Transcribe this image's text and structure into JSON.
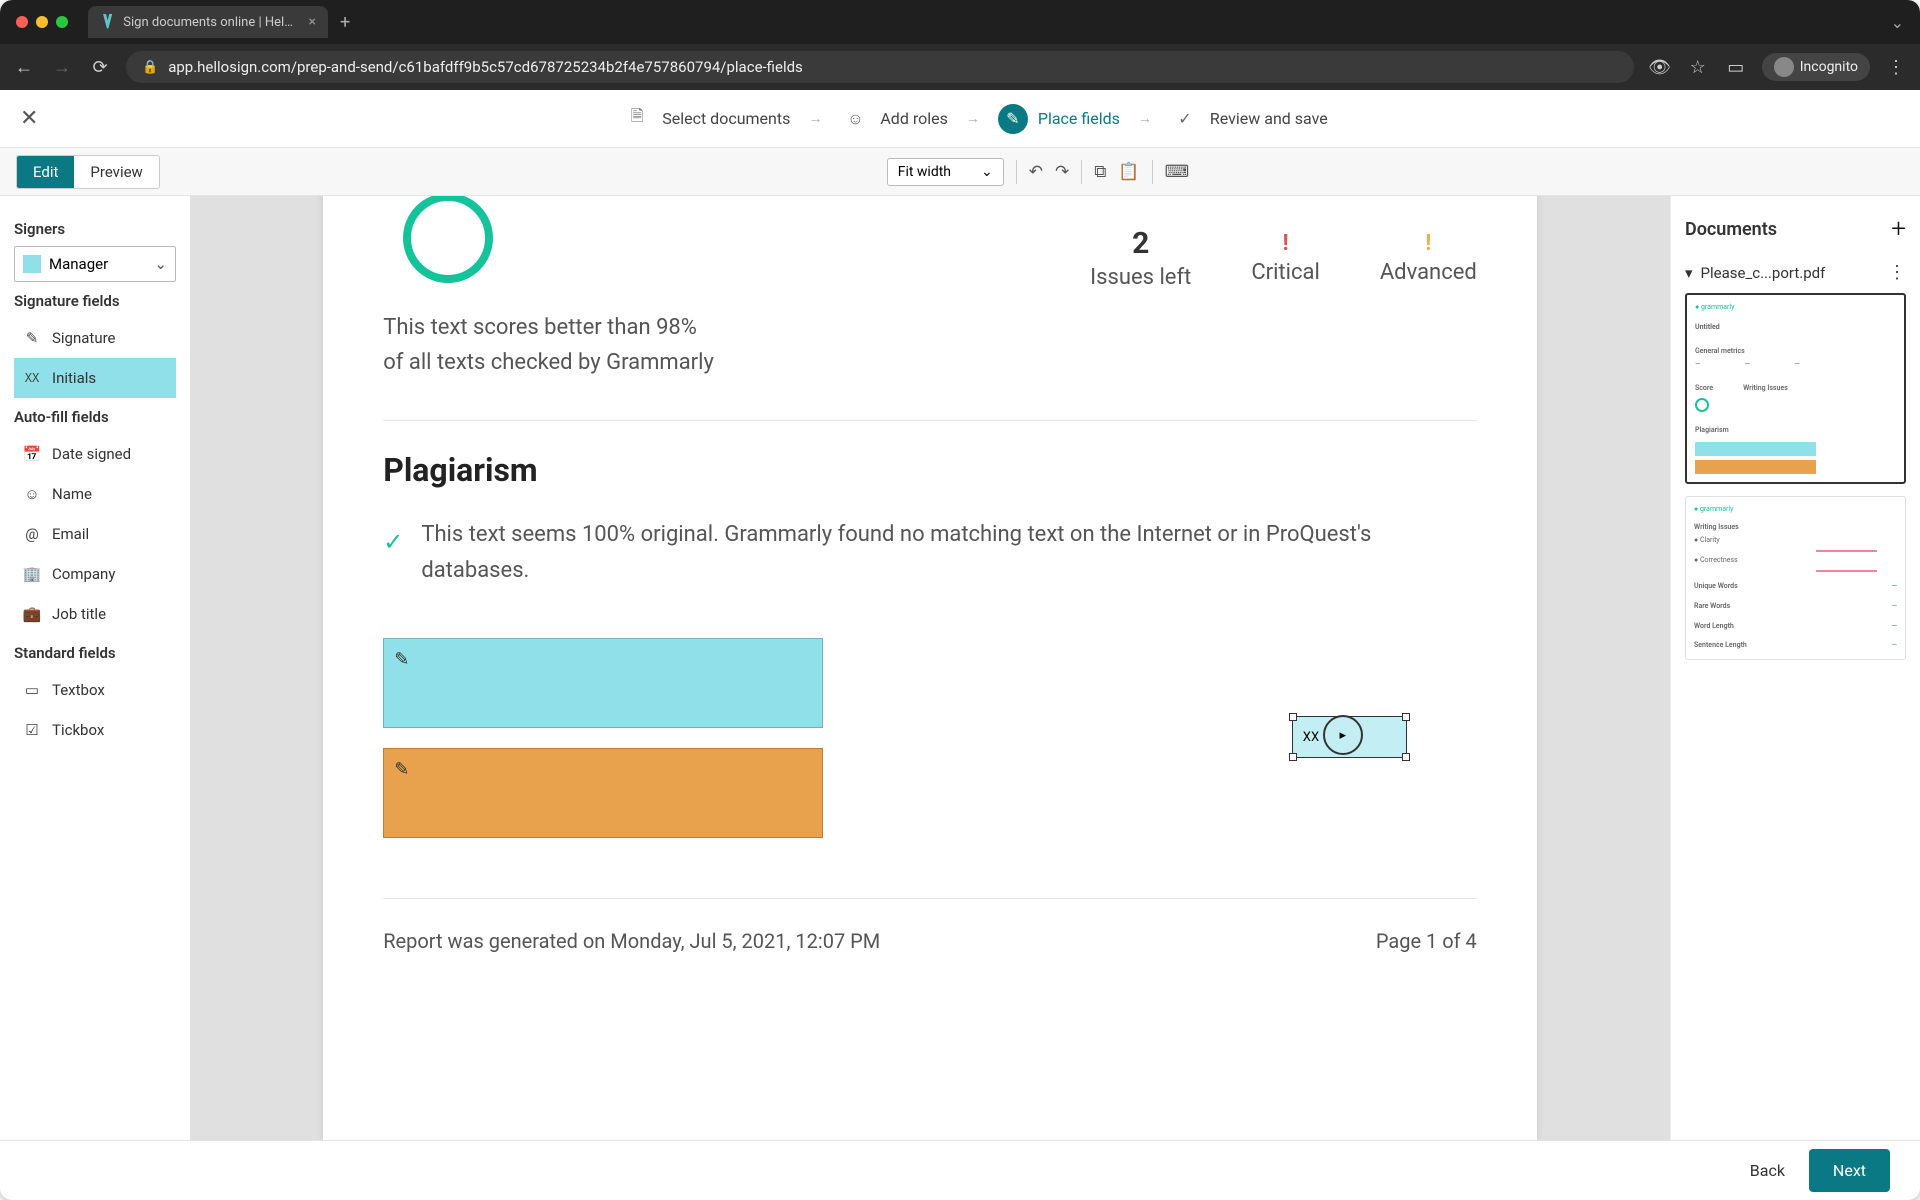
{
  "browser": {
    "tab_title": "Sign documents online | HelloS",
    "url": "app.hellosign.com/prep-and-send/c61bafdff9b5c57cd678725234b2f4e757860794/place-fields",
    "incognito_label": "Incognito"
  },
  "steps": {
    "s1": "Select documents",
    "s2": "Add roles",
    "s3": "Place fields",
    "s4": "Review and save"
  },
  "toolbar": {
    "edit": "Edit",
    "preview": "Preview",
    "fit": "Fit width"
  },
  "left": {
    "signers_h": "Signers",
    "signer_name": "Manager",
    "sigfields_h": "Signature fields",
    "signature": "Signature",
    "initials": "Initials",
    "autofill_h": "Auto-fill fields",
    "date_signed": "Date signed",
    "name": "Name",
    "email": "Email",
    "company": "Company",
    "job_title": "Job title",
    "standard_h": "Standard fields",
    "textbox": "Textbox",
    "tickbox": "Tickbox"
  },
  "doc": {
    "issues_num": "2",
    "issues_label": "Issues left",
    "critical_mark": "!",
    "critical_label": "Critical",
    "advanced_mark": "!",
    "advanced_label": "Advanced",
    "score_line1": "This text scores better than 98%",
    "score_line2": "of all texts checked by Grammarly",
    "plag_h": "Plagiarism",
    "plag_text": "This text seems 100% original. Grammarly found no matching text on the Internet or in ProQuest's databases.",
    "initials_label": "XX",
    "footer_left": "Report was generated on Monday, Jul 5, 2021, 12:07 PM",
    "footer_right": "Page 1 of 4"
  },
  "right": {
    "title": "Documents",
    "doc_name": "Please_c...port.pdf",
    "thumb1_title": "Untitled",
    "thumb1_section1": "General metrics",
    "thumb1_section2": "Score",
    "thumb1_section3": "Writing Issues",
    "thumb1_section4": "Plagiarism",
    "thumb2_s1": "Writing Issues",
    "thumb2_s1a": "Clarity",
    "thumb2_s1b": "Correctness",
    "thumb2_s2": "Unique Words",
    "thumb2_s3": "Rare Words",
    "thumb2_s4": "Word Length",
    "thumb2_s5": "Sentence Length"
  },
  "bottom": {
    "back": "Back",
    "next": "Next"
  },
  "colors": {
    "teal": "#0a7983",
    "field_blue": "#8fe0e9",
    "field_orange": "#e8a14c"
  }
}
